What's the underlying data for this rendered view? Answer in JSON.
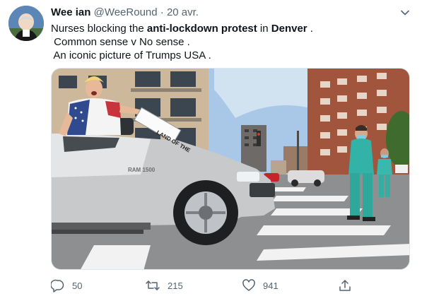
{
  "tweet": {
    "author_name": "Wee ian",
    "handle": "@WeeRound",
    "separator": "·",
    "date": "20 avr.",
    "text": {
      "l1_a": "Nurses blocking the ",
      "l1_b": "anti-lockdown protest",
      "l1_c": " in ",
      "l1_d": "Denver",
      "l1_e": " .",
      "l2": " Common sense v No sense .",
      "l3": " An iconic picture of Trumps USA ."
    },
    "media": {
      "truck_badge": "RAM 1500",
      "sign_text": "LAND OF THE"
    },
    "actions": {
      "reply_count": "50",
      "retweet_count": "215",
      "like_count": "941"
    }
  },
  "icons": {
    "caret": "chevron-down-icon",
    "reply": "reply-icon",
    "retweet": "retweet-icon",
    "like": "heart-icon",
    "share": "share-icon"
  },
  "colors": {
    "text": "#0f1419",
    "muted": "#536471",
    "sky": "#a9c8e8"
  }
}
